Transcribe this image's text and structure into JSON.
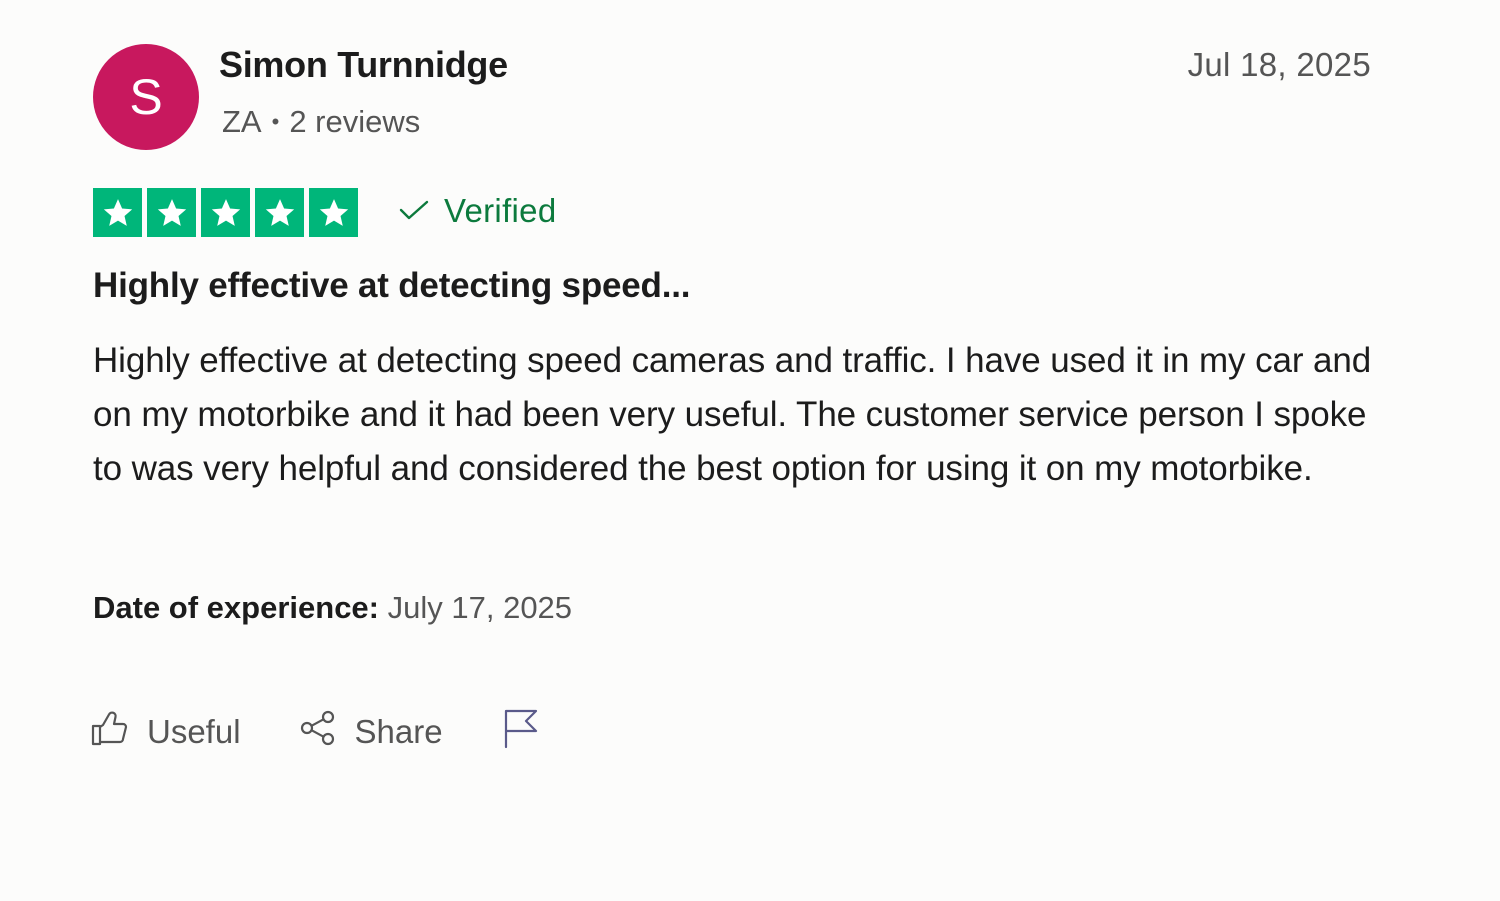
{
  "reviewer": {
    "initial": "S",
    "name": "Simon Turnnidge",
    "country": "ZA",
    "separator": "•",
    "review_count": "2 reviews",
    "avatar_color": "#c8185e"
  },
  "review": {
    "date": "Jul 18, 2025",
    "rating": 5,
    "rating_max": 5,
    "star_color": "#00b67a",
    "verified_label": "Verified",
    "verified_color": "#0c7a3d",
    "title": "Highly effective at detecting speed...",
    "body": "Highly effective at detecting speed cameras and traffic. I have used it in my car and on my motorbike and it had been very useful. The customer service person I spoke to was very helpful and considered the best option for using it on my motorbike.",
    "experience_label": "Date of experience:",
    "experience_date": "July 17, 2025"
  },
  "actions": {
    "useful_label": "Useful",
    "share_label": "Share",
    "useful_icon": "thumbs-up-icon",
    "share_icon": "share-icon",
    "flag_icon": "flag-icon"
  }
}
